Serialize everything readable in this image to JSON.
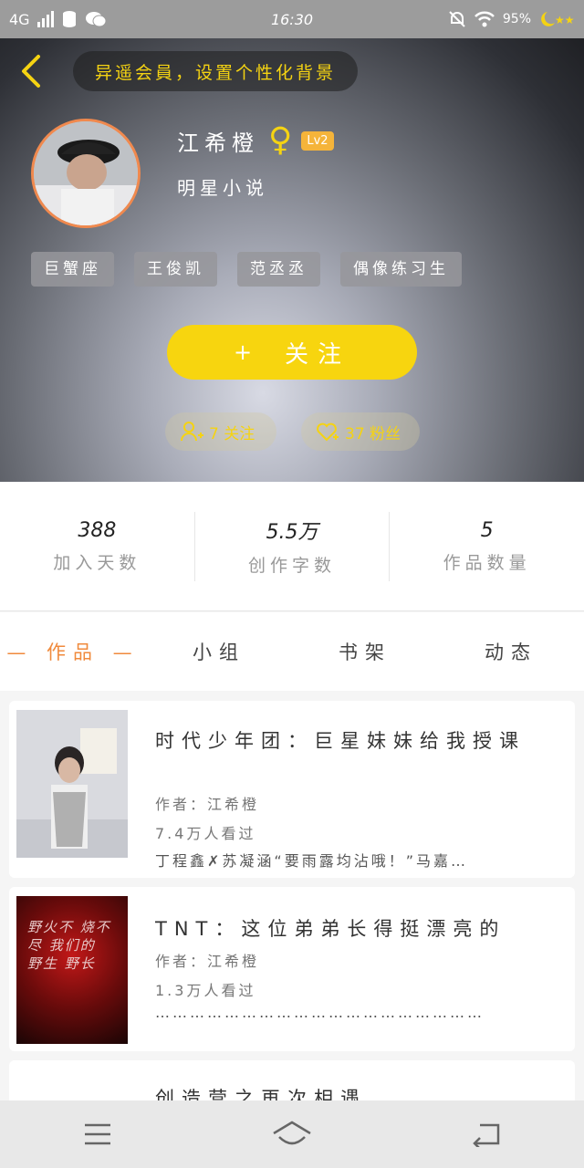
{
  "status_bar": {
    "network": "4G",
    "time": "16:30",
    "battery": "95%"
  },
  "header": {
    "background_hint": "异遥会員，设置个性化背景",
    "name": "江希橙",
    "gender_icon": "female-icon",
    "level": "Lv2",
    "subtitle": "明星小说",
    "tags": [
      "巨蟹座",
      "王俊凯",
      "范丞丞",
      "偶像练习生"
    ],
    "follow_button": {
      "plus": "+",
      "label": "关注"
    },
    "following": "7 关注",
    "fans": "37 粉丝"
  },
  "stats": [
    {
      "value": "388",
      "label": "加入天数"
    },
    {
      "value": "5.5万",
      "label": "创作字数"
    },
    {
      "value": "5",
      "label": "作品数量"
    }
  ],
  "tabs": [
    {
      "label": "— 作品 —",
      "active": true
    },
    {
      "label": "小组",
      "active": false
    },
    {
      "label": "书架",
      "active": false
    },
    {
      "label": "动态",
      "active": false
    }
  ],
  "works": [
    {
      "title": "时代少年团：巨星妹妹给我授课",
      "author": "作者：江希橙",
      "views": "7.4万人看过",
      "desc": "丁程鑫✗苏凝涵“要雨露均沾哦！”马嘉…"
    },
    {
      "title": "TNT：这位弟弟长得挺漂亮的",
      "author": "作者：江希橙",
      "views": "1.3万人看过",
      "desc": "…………………………………………………"
    },
    {
      "title": "创造营之再次相遇"
    }
  ],
  "cover2_text": "野火不 烧不尽 我们的 野生 野长"
}
